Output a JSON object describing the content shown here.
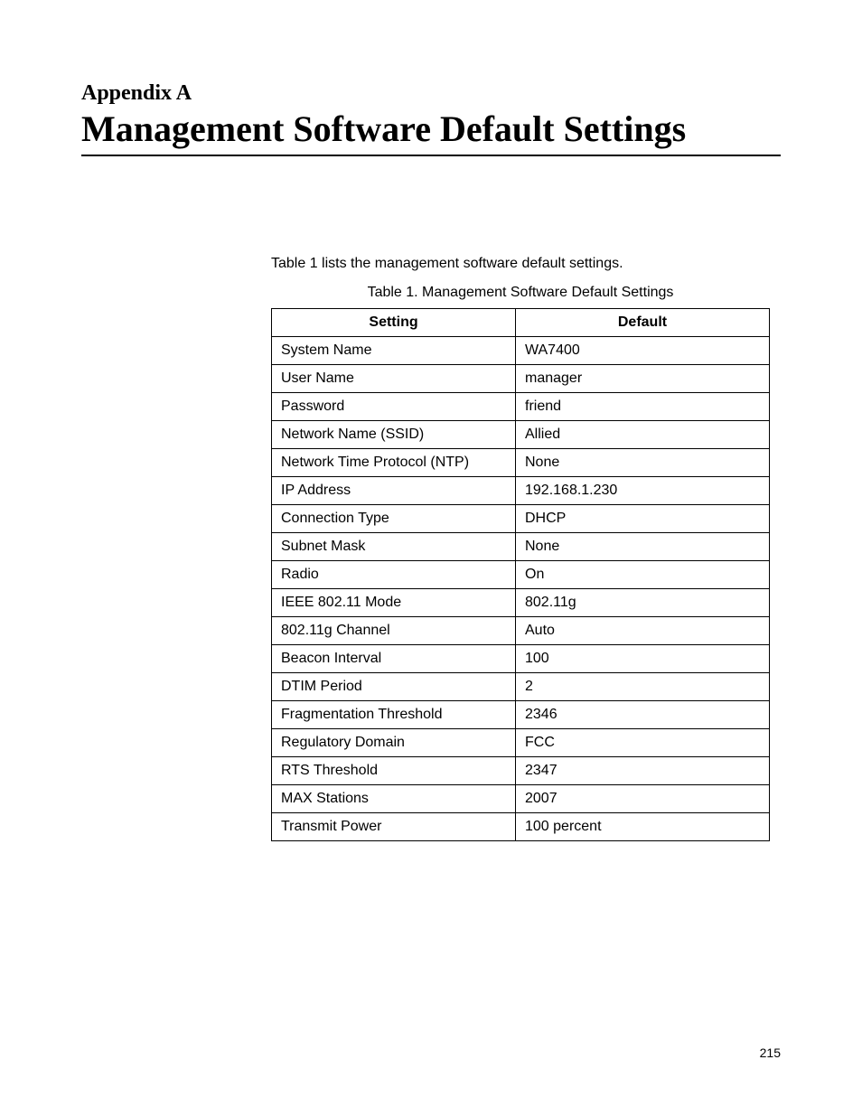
{
  "header": {
    "appendix_label": "Appendix A",
    "title": "Management Software Default Settings"
  },
  "intro_text": "Table 1 lists the management software default settings.",
  "table": {
    "caption": "Table 1. Management Software Default Settings",
    "headers": {
      "col1": "Setting",
      "col2": "Default"
    },
    "rows": [
      {
        "setting": "System Name",
        "default": "WA7400"
      },
      {
        "setting": "User Name",
        "default": "manager"
      },
      {
        "setting": "Password",
        "default": "friend"
      },
      {
        "setting": "Network Name (SSID)",
        "default": "Allied"
      },
      {
        "setting": "Network Time Protocol (NTP)",
        "default": "None"
      },
      {
        "setting": "IP Address",
        "default": "192.168.1.230"
      },
      {
        "setting": "Connection Type",
        "default": "DHCP"
      },
      {
        "setting": "Subnet Mask",
        "default": "None"
      },
      {
        "setting": "Radio",
        "default": "On"
      },
      {
        "setting": "IEEE 802.11 Mode",
        "default": "802.11g"
      },
      {
        "setting": "802.11g Channel",
        "default": "Auto"
      },
      {
        "setting": "Beacon Interval",
        "default": "100"
      },
      {
        "setting": "DTIM Period",
        "default": "2"
      },
      {
        "setting": "Fragmentation Threshold",
        "default": "2346"
      },
      {
        "setting": "Regulatory Domain",
        "default": "FCC"
      },
      {
        "setting": "RTS Threshold",
        "default": "2347"
      },
      {
        "setting": "MAX Stations",
        "default": "2007"
      },
      {
        "setting": "Transmit Power",
        "default": "100 percent"
      }
    ]
  },
  "page_number": "215"
}
